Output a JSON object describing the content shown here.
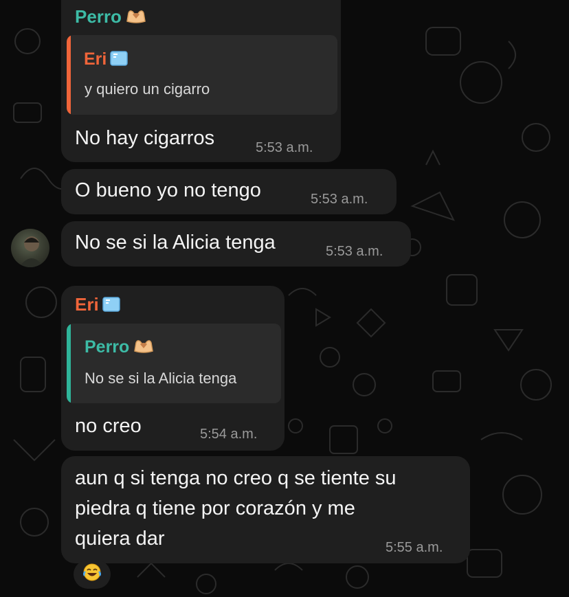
{
  "messages": [
    {
      "sender": "Perro",
      "quote_name": "Eri",
      "quote_text": "y quiero un cigarro",
      "text": "No hay cigarros",
      "time": "5:53 a.m."
    },
    {
      "text": "O bueno yo no tengo",
      "time": "5:53 a.m."
    },
    {
      "text": "No se si la Alicia tenga",
      "time": "5:53 a.m."
    },
    {
      "sender": "Eri",
      "quote_name": "Perro",
      "quote_text": "No se si la Alicia tenga",
      "text": "no creo",
      "time": "5:54 a.m."
    },
    {
      "lines": [
        "aun q si tenga no creo q se tiente su",
        "piedra q tiene por corazón y me",
        "quiera dar"
      ],
      "time": "5:55 a.m."
    }
  ],
  "reaction": "😂",
  "colors": {
    "perro_name": "#3dbba6",
    "eri_name": "#f0653a",
    "eri_quote_bar": "#f0653a",
    "perro_quote_bar": "#2fb59a"
  },
  "icons": {
    "perro": "heart-hands-icon",
    "eri": "ice-cube-icon"
  }
}
